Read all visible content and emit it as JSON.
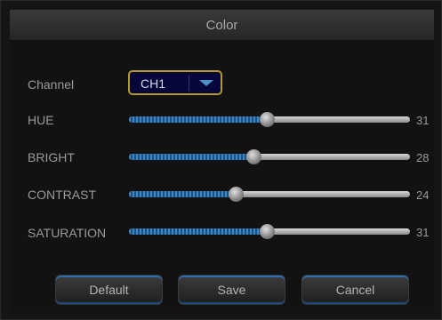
{
  "dialog": {
    "title": "Color"
  },
  "channel": {
    "label": "Channel",
    "value": "CH1"
  },
  "sliders": [
    {
      "label": "HUE",
      "value": 31
    },
    {
      "label": "BRIGHT",
      "value": 28
    },
    {
      "label": "CONTRAST",
      "value": 24
    },
    {
      "label": "SATURATION",
      "value": 31
    }
  ],
  "slider_max": 63,
  "buttons": {
    "default": "Default",
    "save": "Save",
    "cancel": "Cancel"
  }
}
